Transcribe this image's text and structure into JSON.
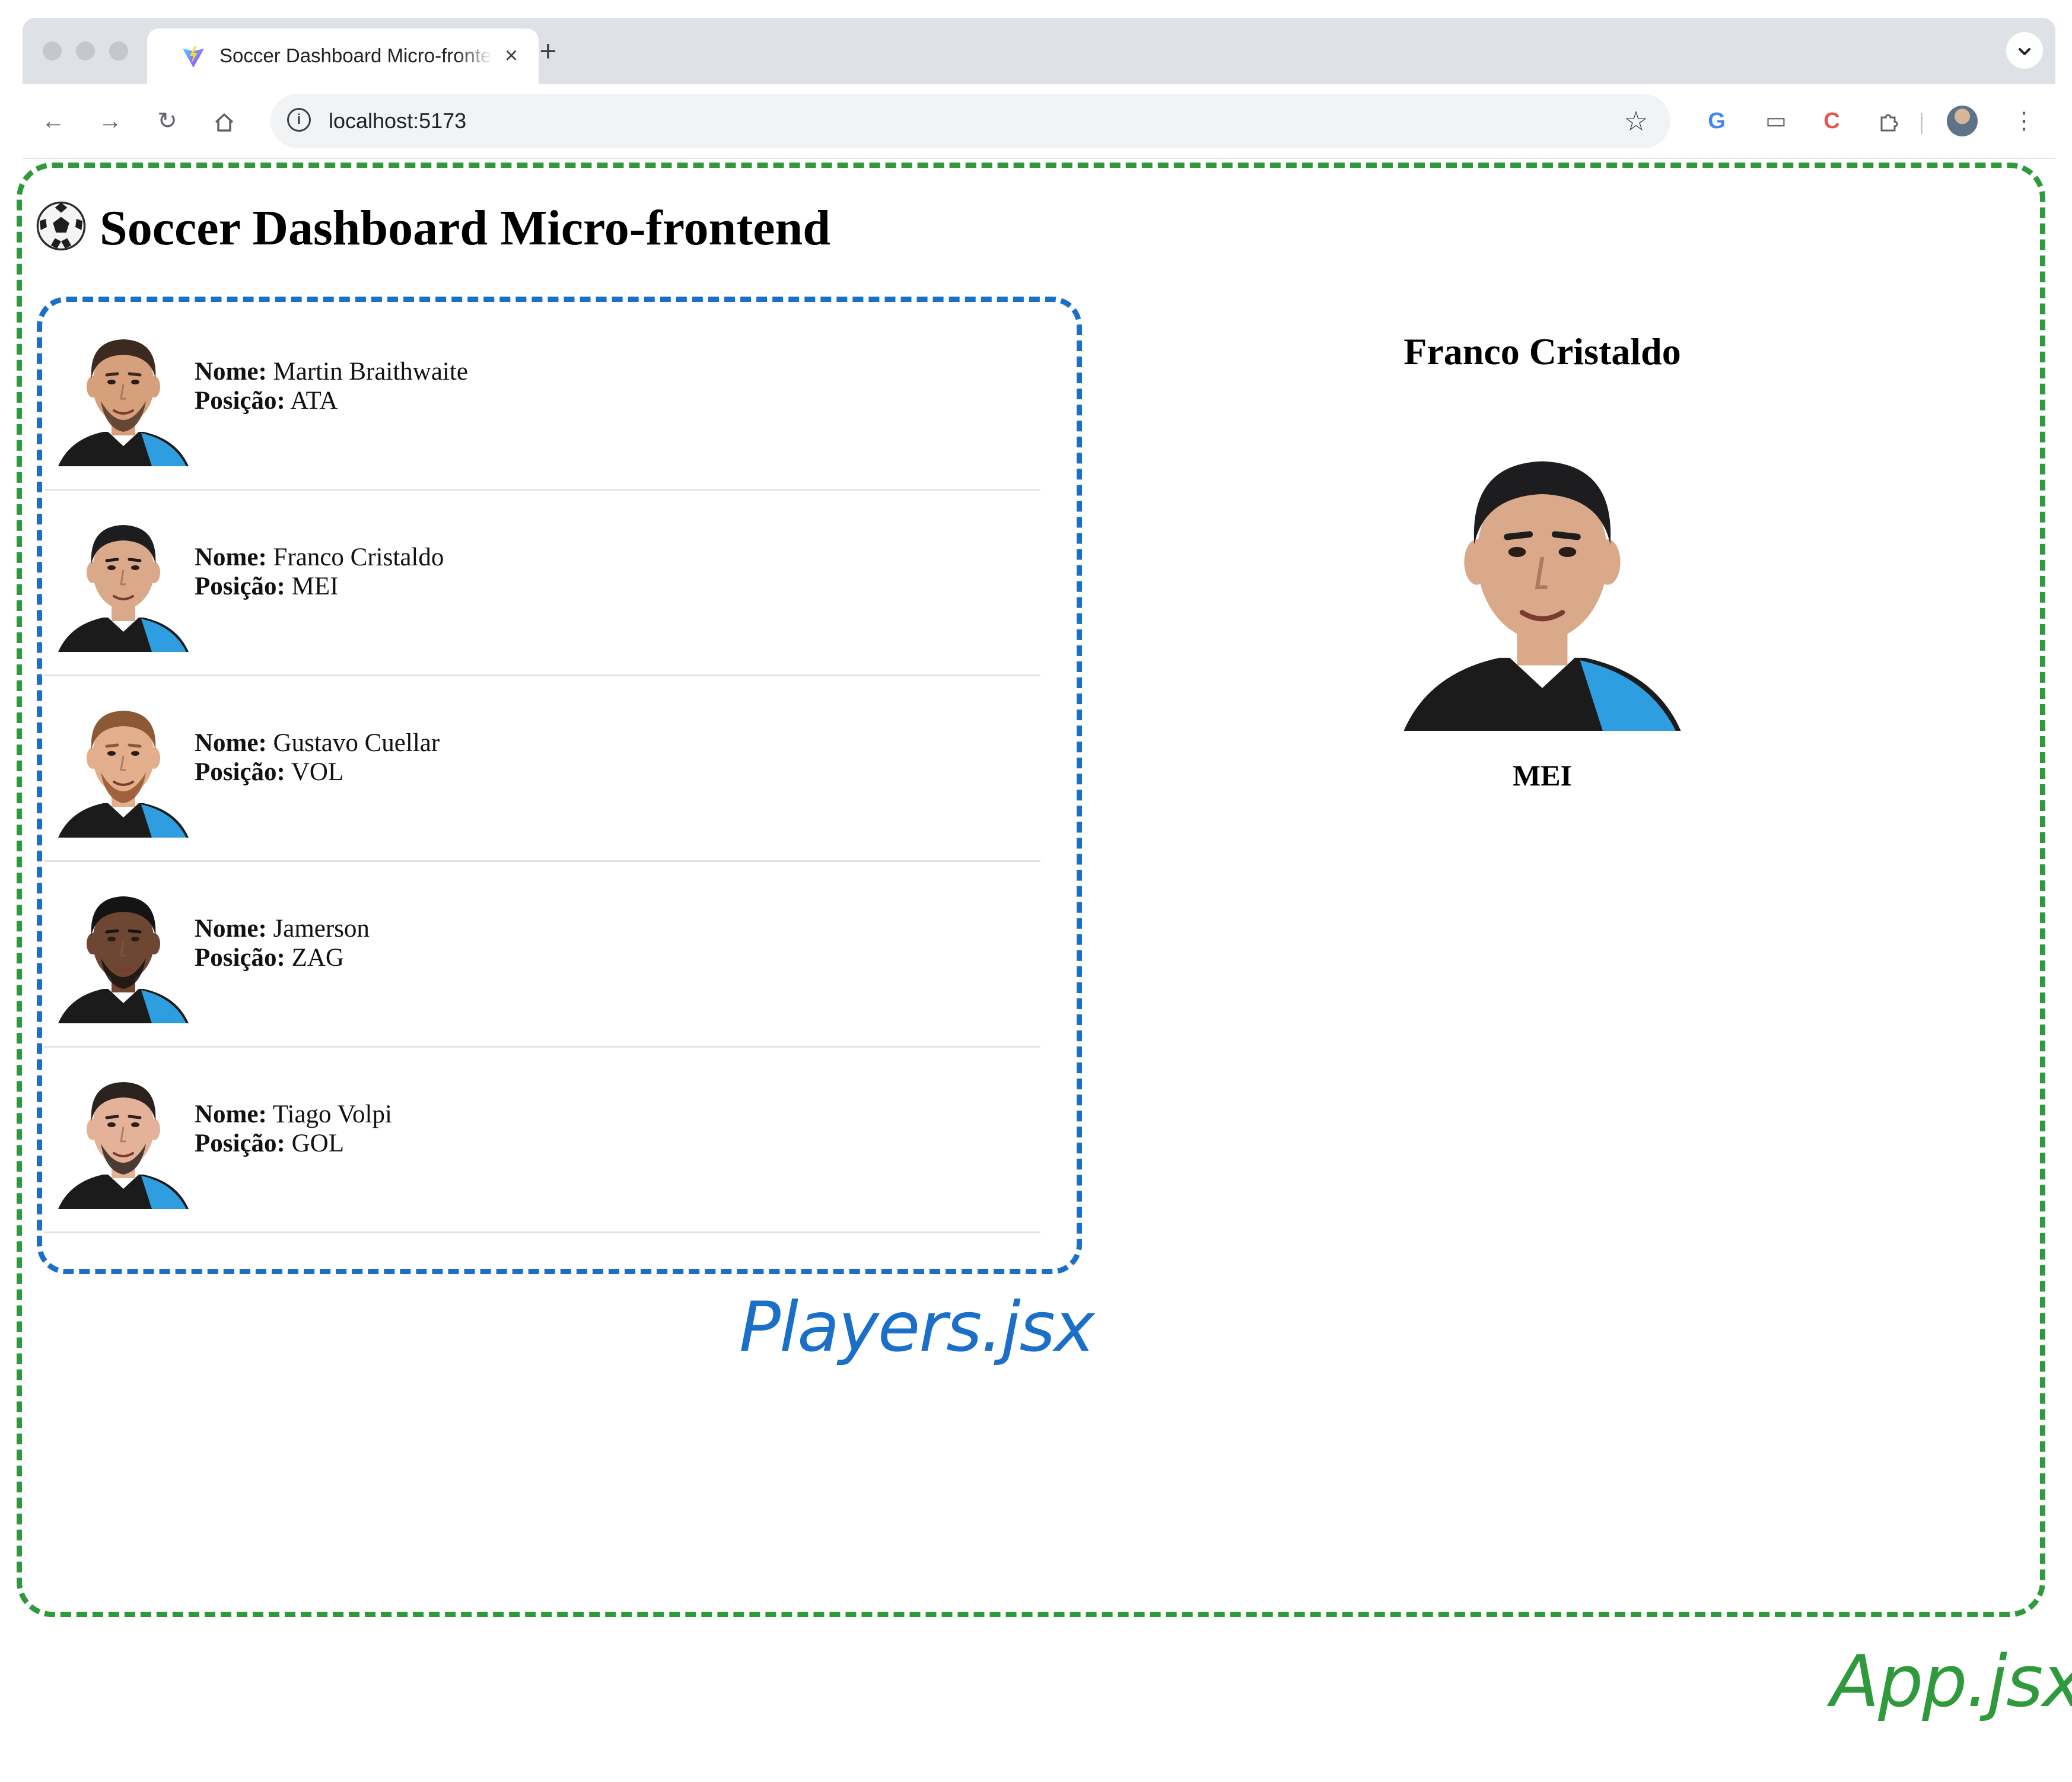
{
  "browser": {
    "tab_title": "Soccer Dashboard Micro-frontend",
    "tab_close": "×",
    "new_tab": "+",
    "url": "localhost:5173",
    "icons": {
      "back": "back-arrow-icon",
      "forward": "forward-arrow-icon",
      "reload": "reload-icon",
      "home": "home-icon",
      "site_info": "info-icon",
      "bookmark": "star-icon",
      "extensions": "puzzle-icon",
      "menu": "kebab-menu-icon"
    }
  },
  "page": {
    "title": "Soccer Dashboard Micro-frontend",
    "title_icon": "soccer-ball-icon"
  },
  "players": {
    "name_label": "Nome:",
    "position_label": "Posição:",
    "items": [
      {
        "name": "Martin Braithwaite",
        "position": "ATA",
        "skin": "#d7a07c",
        "hair": "#3b2a20",
        "beard": "#5a3d2b"
      },
      {
        "name": "Franco Cristaldo",
        "position": "MEI",
        "skin": "#d9a98a",
        "hair": "#1d1d1f",
        "beard": ""
      },
      {
        "name": "Gustavo Cuellar",
        "position": "VOL",
        "skin": "#e2ae8c",
        "hair": "#8b5a34",
        "beard": "#9a5a32"
      },
      {
        "name": "Jamerson",
        "position": "ZAG",
        "skin": "#6e4634",
        "hair": "#141414",
        "beard": "#1d1412"
      },
      {
        "name": "Tiago Volpi",
        "position": "GOL",
        "skin": "#e4b299",
        "hair": "#2b211d",
        "beard": "#3a2c26"
      }
    ]
  },
  "selected_player": {
    "name": "Franco Cristaldo",
    "position": "MEI"
  },
  "annotations": {
    "players_component": "Players.jsx",
    "app_component": "App.jsx"
  },
  "colors": {
    "app_outline": "#2f9a3c",
    "players_outline": "#1a6fc9",
    "jersey_blue": "#2f9ee0",
    "jersey_black": "#1b1b1b"
  }
}
